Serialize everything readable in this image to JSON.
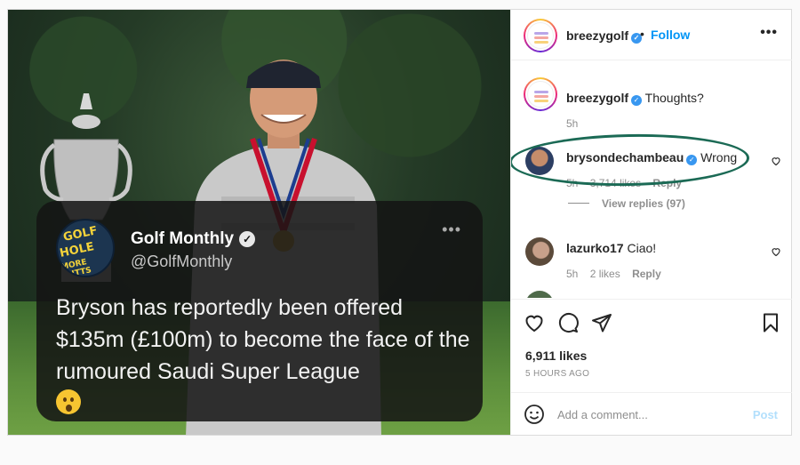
{
  "post": {
    "author": "breezygolf",
    "follow_label": "Follow",
    "separator": "•",
    "more_label": "•••"
  },
  "tweet": {
    "name": "Golf Monthly",
    "handle": "@GolfMonthly",
    "text": "Bryson has reportedly been offered $135m (£100m) to become the face of the rumoured Saudi Super League",
    "avatar_text": [
      "HOLE",
      "MORE PUTTS",
      "GOLF"
    ]
  },
  "comments": [
    {
      "user": "breezygolf",
      "text": "Thoughts?",
      "time": "5h",
      "likes": "",
      "reply": ""
    },
    {
      "user": "brysondechambeau",
      "text": "Wrong",
      "time": "5h",
      "likes": "3,714 likes",
      "reply": "Reply"
    },
    {
      "user": "lazurko17",
      "text": "Ciao!",
      "time": "5h",
      "likes": "2 likes",
      "reply": "Reply"
    }
  ],
  "view_replies": "View replies (97)",
  "likes_count": "6,911 likes",
  "time_ago": "5 HOURS AGO",
  "add_comment_placeholder": "Add a comment...",
  "post_label": "Post",
  "colors": {
    "accent": "#0095f6",
    "highlight": "#1b6a55",
    "verified": "#3897f0"
  }
}
